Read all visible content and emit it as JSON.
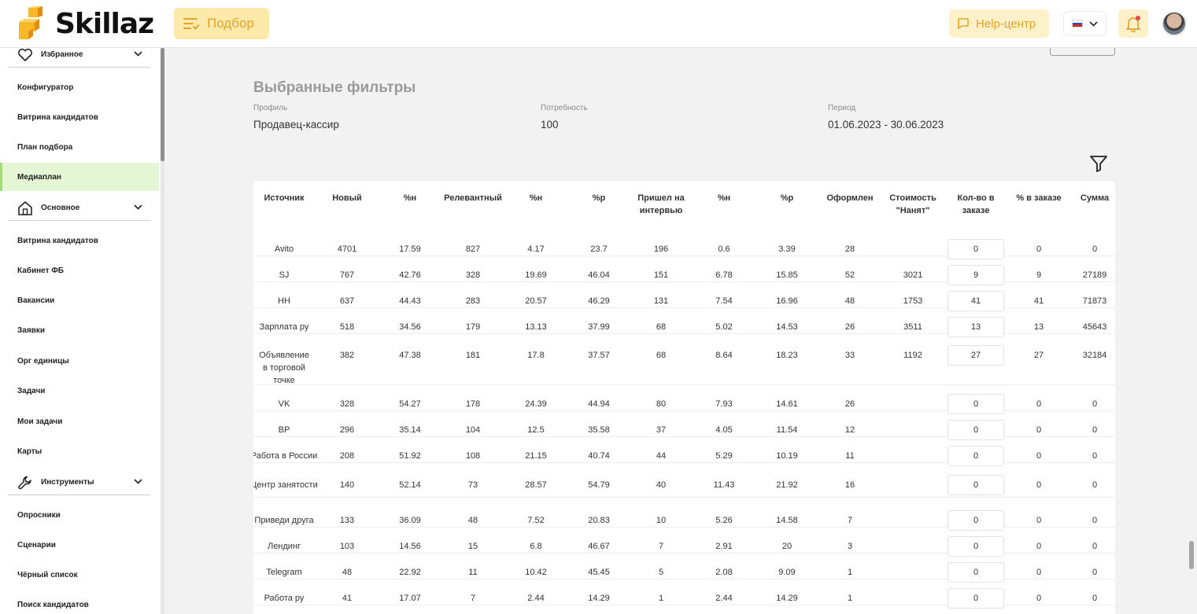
{
  "header": {
    "logo_text": "Skillaz",
    "podbor_label": "Подбор",
    "help_label": "Help-центр",
    "language_flag": "ru"
  },
  "sidebar": {
    "groups": [
      {
        "label": "Избранное"
      },
      {
        "label": "Основное"
      },
      {
        "label": "Инструменты"
      }
    ],
    "items": [
      {
        "label": "Конфигуратор"
      },
      {
        "label": "Витрина кандидатов"
      },
      {
        "label": "План подбора"
      },
      {
        "label": "Медиаплан"
      },
      {
        "label": "Витрина кандидатов"
      },
      {
        "label": "Кабинет ФБ"
      },
      {
        "label": "Вакансии"
      },
      {
        "label": "Заявки"
      },
      {
        "label": "Орг единицы"
      },
      {
        "label": "Задачи"
      },
      {
        "label": "Мои задачи"
      },
      {
        "label": "Карты"
      },
      {
        "label": "Опросники"
      },
      {
        "label": "Сценарии"
      },
      {
        "label": "Чёрный список"
      },
      {
        "label": "Поиск кандидатов"
      }
    ]
  },
  "filters": {
    "title": "Выбранные фильтры",
    "profile_label": "Профиль",
    "profile_value": "Продавец-кассир",
    "need_label": "Потребность",
    "need_value": "100",
    "period_label": "Период",
    "period_value": "01.06.2023 - 30.06.2023"
  },
  "table": {
    "headers": [
      {
        "text": "Источник"
      },
      {
        "text": "Новый"
      },
      {
        "text": "%н"
      },
      {
        "text": "Релевантный"
      },
      {
        "text": "%н"
      },
      {
        "text": "%р"
      },
      {
        "text": "Пришел на интервью"
      },
      {
        "text": "%н"
      },
      {
        "text": "%р"
      },
      {
        "text": "Оформлен"
      },
      {
        "text": "Стоимость \"Нанят\""
      },
      {
        "text": "Кол-во в заказе"
      },
      {
        "text": "% в заказе"
      },
      {
        "text": "Сумма"
      }
    ],
    "rows": [
      {
        "source": "Avito",
        "c": [
          "4701",
          "17.59",
          "827",
          "4.17",
          "23.7",
          "196",
          "0.6",
          "3.39",
          "28",
          ""
        ],
        "qty": "0",
        "pct": "0",
        "sum": "0"
      },
      {
        "source": "SJ",
        "c": [
          "767",
          "42.76",
          "328",
          "19.69",
          "46.04",
          "151",
          "6.78",
          "15.85",
          "52",
          "3021"
        ],
        "qty": "9",
        "pct": "9",
        "sum": "27189"
      },
      {
        "source": "HH",
        "c": [
          "637",
          "44.43",
          "283",
          "20.57",
          "46.29",
          "131",
          "7.54",
          "16.96",
          "48",
          "1753"
        ],
        "qty": "41",
        "pct": "41",
        "sum": "71873"
      },
      {
        "source": "Зарплата ру",
        "c": [
          "518",
          "34.56",
          "179",
          "13.13",
          "37.99",
          "68",
          "5.02",
          "14.53",
          "26",
          "3511"
        ],
        "qty": "13",
        "pct": "13",
        "sum": "45643"
      },
      {
        "source": "Объявление в торговой точке",
        "c": [
          "382",
          "47.38",
          "181",
          "17.8",
          "37.57",
          "68",
          "8.64",
          "18.23",
          "33",
          "1192"
        ],
        "qty": "27",
        "pct": "27",
        "sum": "32184"
      },
      {
        "source": "VK",
        "c": [
          "328",
          "54.27",
          "178",
          "24.39",
          "44.94",
          "80",
          "7.93",
          "14.61",
          "26",
          ""
        ],
        "qty": "0",
        "pct": "0",
        "sum": "0"
      },
      {
        "source": "BP",
        "c": [
          "296",
          "35.14",
          "104",
          "12.5",
          "35.58",
          "37",
          "4.05",
          "11.54",
          "12",
          ""
        ],
        "qty": "0",
        "pct": "0",
        "sum": "0"
      },
      {
        "source": "Работа в России",
        "c": [
          "208",
          "51.92",
          "108",
          "21.15",
          "40.74",
          "44",
          "5.29",
          "10.19",
          "11",
          ""
        ],
        "qty": "0",
        "pct": "0",
        "sum": "0"
      },
      {
        "source": "Центр занятости",
        "c": [
          "140",
          "52.14",
          "73",
          "28.57",
          "54.79",
          "40",
          "11.43",
          "21.92",
          "16",
          ""
        ],
        "qty": "0",
        "pct": "0",
        "sum": "0"
      },
      {
        "source": "Приведи друга",
        "c": [
          "133",
          "36.09",
          "48",
          "7.52",
          "20.83",
          "10",
          "5.26",
          "14.58",
          "7",
          ""
        ],
        "qty": "0",
        "pct": "0",
        "sum": "0"
      },
      {
        "source": "Лендинг",
        "c": [
          "103",
          "14.56",
          "15",
          "6.8",
          "46.67",
          "7",
          "2.91",
          "20",
          "3",
          ""
        ],
        "qty": "0",
        "pct": "0",
        "sum": "0"
      },
      {
        "source": "Telegram",
        "c": [
          "48",
          "22.92",
          "11",
          "10.42",
          "45.45",
          "5",
          "2.08",
          "9.09",
          "1",
          ""
        ],
        "qty": "0",
        "pct": "0",
        "sum": "0"
      },
      {
        "source": "Работа ру",
        "c": [
          "41",
          "17.07",
          "7",
          "2.44",
          "14.29",
          "1",
          "2.44",
          "14.29",
          "1",
          ""
        ],
        "qty": "0",
        "pct": "0",
        "sum": "0"
      }
    ]
  }
}
